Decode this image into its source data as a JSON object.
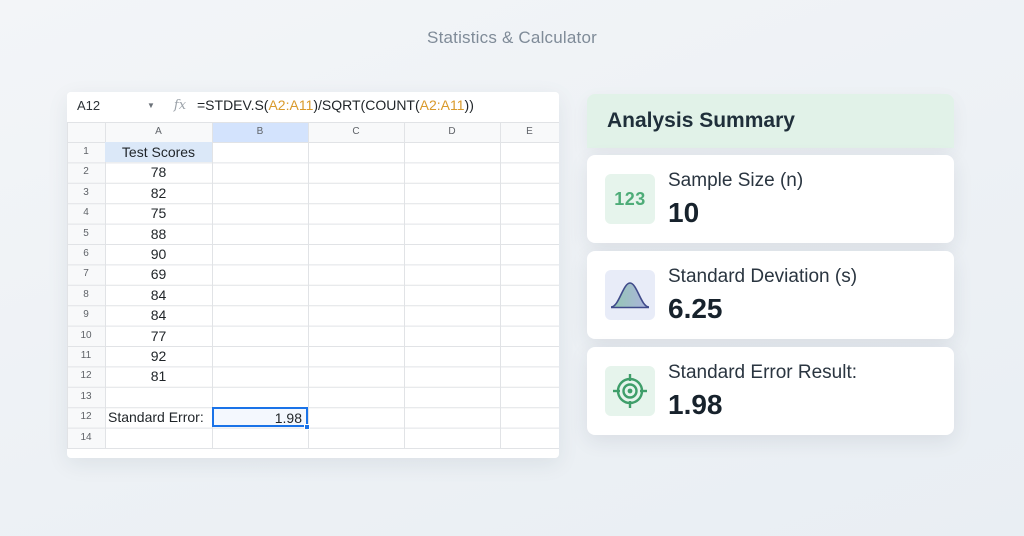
{
  "page": {
    "title": "Statistics & Calculator"
  },
  "spreadsheet": {
    "name_box": "A12",
    "formula_parts": [
      {
        "text": "=STDEV.S(",
        "ref": false
      },
      {
        "text": "A2:A11",
        "ref": true
      },
      {
        "text": ")/SQRT(COUNT(",
        "ref": false
      },
      {
        "text": "A2:A11",
        "ref": true
      },
      {
        "text": "))",
        "ref": false
      }
    ],
    "columns": [
      "A",
      "B",
      "C",
      "D",
      "E"
    ],
    "row_labels": [
      "1",
      "2",
      "3",
      "4",
      "5",
      "6",
      "7",
      "8",
      "9",
      "10",
      "11",
      "12",
      "13",
      "12",
      "14"
    ],
    "header_cell": "Test Scores",
    "scores": [
      "78",
      "82",
      "75",
      "88",
      "90",
      "69",
      "84",
      "84",
      "77",
      "92",
      "81"
    ],
    "result_label": "Standard Error:",
    "result_value": "1.98",
    "colors": {
      "reference": "#d99a2b",
      "selection": "#1a73e8",
      "header_fill": "#dbe8f8"
    }
  },
  "summary": {
    "title": "Analysis Summary",
    "cards": [
      {
        "icon": "number-123-icon",
        "icon_text": "123",
        "label": "Sample Size (n)",
        "value": "10"
      },
      {
        "icon": "bell-curve-icon",
        "label": "Standard Deviation (s)",
        "value": "6.25"
      },
      {
        "icon": "target-icon",
        "label": "Standard Error Result:",
        "value": "1.98"
      }
    ],
    "colors": {
      "header_bg": "#e1f2e8",
      "accent_green": "#4eac78",
      "accent_purple": "#7c83c9"
    }
  }
}
